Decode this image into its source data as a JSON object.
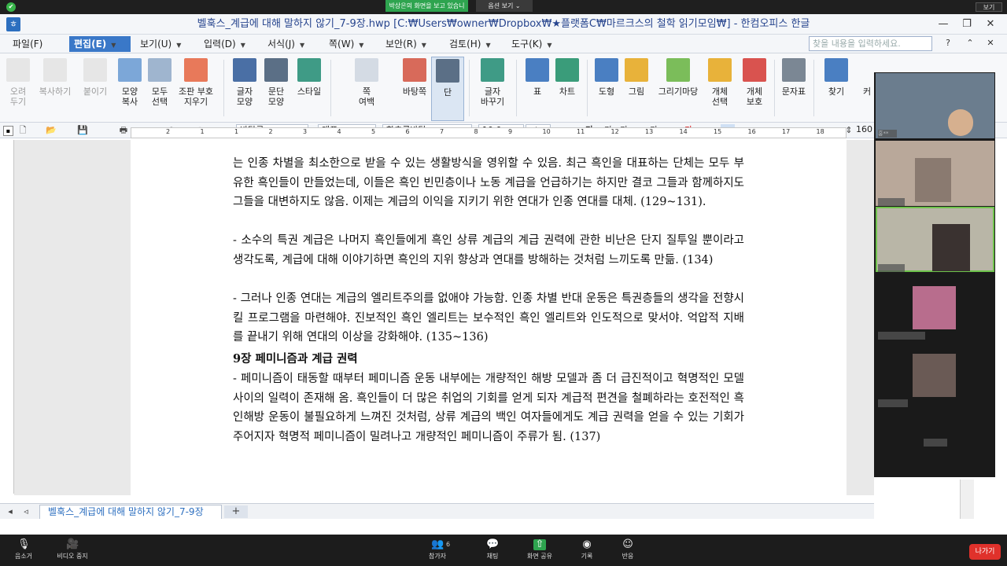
{
  "zoom_top": {
    "share_banner": "박상은의 화면을 보고 있습니다.",
    "view_options": "옵션 보기 ⌄",
    "view_button": "보기"
  },
  "window": {
    "title": "벨훅스_계급에 대해 말하지 않기_7-9장.hwp [C:₩Users₩owner₩Dropbox₩★플랫폼C₩마르크스의 철학 읽기모임₩] - 한컴오피스 한글"
  },
  "menu": [
    {
      "label": "파일(F)"
    },
    {
      "label": "편집(E)"
    },
    {
      "label": "보기(U)"
    },
    {
      "label": "입력(D)"
    },
    {
      "label": "서식(J)"
    },
    {
      "label": "쪽(W)"
    },
    {
      "label": "보안(R)"
    },
    {
      "label": "검토(H)"
    },
    {
      "label": "도구(K)"
    }
  ],
  "search": {
    "placeholder": "찾을 내용을 입력하세요."
  },
  "ribbon": [
    {
      "label": "오려\n두기",
      "icon": "scissors-icon"
    },
    {
      "label": "복사하기",
      "icon": "copy-icon"
    },
    {
      "label": "붙이기",
      "icon": "paste-icon"
    },
    {
      "label": "모양\n복사",
      "icon": "format-painter-icon"
    },
    {
      "label": "모두\n선택",
      "icon": "select-all-icon"
    },
    {
      "label": "조판 부호\n지우기",
      "icon": "clear-format-icon"
    },
    {
      "label": "글자\n모양",
      "icon": "char-shape-icon"
    },
    {
      "label": "문단\n모양",
      "icon": "para-shape-icon"
    },
    {
      "label": "스타일",
      "icon": "style-icon"
    },
    {
      "label": "쪽\n여백",
      "icon": "page-margin-icon"
    },
    {
      "label": "바탕쪽",
      "icon": "master-page-icon"
    },
    {
      "label": "단",
      "icon": "columns-icon"
    },
    {
      "label": "글자\n바꾸기",
      "icon": "change-char-icon"
    },
    {
      "label": "표",
      "icon": "table-icon"
    },
    {
      "label": "차트",
      "icon": "chart-icon"
    },
    {
      "label": "도형",
      "icon": "shape-icon"
    },
    {
      "label": "그림",
      "icon": "picture-icon"
    },
    {
      "label": "그리기마당",
      "icon": "clipart-icon"
    },
    {
      "label": "개체\n선택",
      "icon": "object-select-icon"
    },
    {
      "label": "개체\n보호",
      "icon": "object-protect-icon"
    },
    {
      "label": "문자표",
      "icon": "symbol-icon"
    },
    {
      "label": "찾기",
      "icon": "find-icon"
    },
    {
      "label": "커",
      "icon": "more-icon"
    }
  ],
  "format_bar": {
    "style": "바탕글",
    "lang": "대표",
    "font": "함초롬바탕",
    "size": "10.0",
    "unit": "pt",
    "zoom": "160"
  },
  "ruler_numbers": [
    "2",
    "1",
    "1",
    "2",
    "3",
    "4",
    "5",
    "6",
    "7",
    "8",
    "9",
    "10",
    "11",
    "12",
    "13",
    "14",
    "15",
    "16",
    "17",
    "18"
  ],
  "document": {
    "paragraphs": [
      "는 인종 차별을 최소한으로 받을 수 있는 생활방식을 영위할 수 있음. 최근 흑인을 대표하는 단체는 모두 부유한 흑인들이 만들었는데, 이들은 흑인 빈민층이나 노동 계급을 언급하기는 하지만 결코 그들과 함께하지도 그들을 대변하지도 않음. 이제는 계급의 이익을 지키기 위한 연대가 인종 연대를 대체. (129~131).",
      "- 소수의 특권 계급은 나머지 흑인들에게 흑인 상류 계급의 계급 권력에 관한 비난은 단지 질투일 뿐이라고 생각도록, 계급에 대해 이야기하면 흑인의 지위 향상과 연대를 방해하는 것처럼 느끼도록 만듦. (134)",
      "- 그러나 인종 연대는 계급의 엘리트주의를 없애야 가능함. 인종 차별 반대 운동은 특권층들의 생각을 전향시킬 프로그램을 마련해야. 진보적인 흑인 엘리트는 보수적인 흑인 엘리트와 인도적으로 맞서야. 억압적 지배를 끝내기 위해 연대의 이상을 강화해야. (135~136)"
    ],
    "heading": "9장 페미니즘과 계급 권력",
    "para_after": "- 페미니즘이 태동할 때부터 페미니즘 운동 내부에는 개량적인 해방 모델과 좀 더 급진적이고 혁명적인 모델 사이의 일력이 존재해 옴. 흑인들이 더 많은 취업의 기회를 얻게 되자 계급적 편견을 철폐하라는 호전적인 흑인해방 운동이 불필요하게 느껴진 것처럼, 상류 계급의 백인 여자들에게도 계급 권력을 얻을 수 있는 기회가 주어지자 혁명적 페미니즘이 밀려나고 개량적인 페미니즘이 주류가 됨. (137)"
  },
  "doc_tab": "벨훅스_계급에 대해 말하지 않기_7-9장",
  "participants": [
    {
      "name": "홍**",
      "color": "#6b7d8e"
    },
    {
      "name": "",
      "color": "#b9a89a"
    },
    {
      "name": "",
      "color": "#b9b6a7"
    },
    {
      "name": "",
      "color": "#b86d8d"
    },
    {
      "name": "",
      "color": "#6a5a55"
    },
    {
      "name": "",
      "color": "#2b2b2b"
    }
  ],
  "zoom_bottom": [
    {
      "label": "음소거",
      "icon": "mic-icon"
    },
    {
      "label": "비디오 중지",
      "icon": "video-icon"
    },
    {
      "label": "참가자",
      "icon": "participants-icon",
      "count": "6"
    },
    {
      "label": "채팅",
      "icon": "chat-icon"
    },
    {
      "label": "화면 공유",
      "icon": "share-screen-icon"
    },
    {
      "label": "기록",
      "icon": "record-icon"
    },
    {
      "label": "반응",
      "icon": "reaction-icon"
    }
  ],
  "leave": "나가기"
}
